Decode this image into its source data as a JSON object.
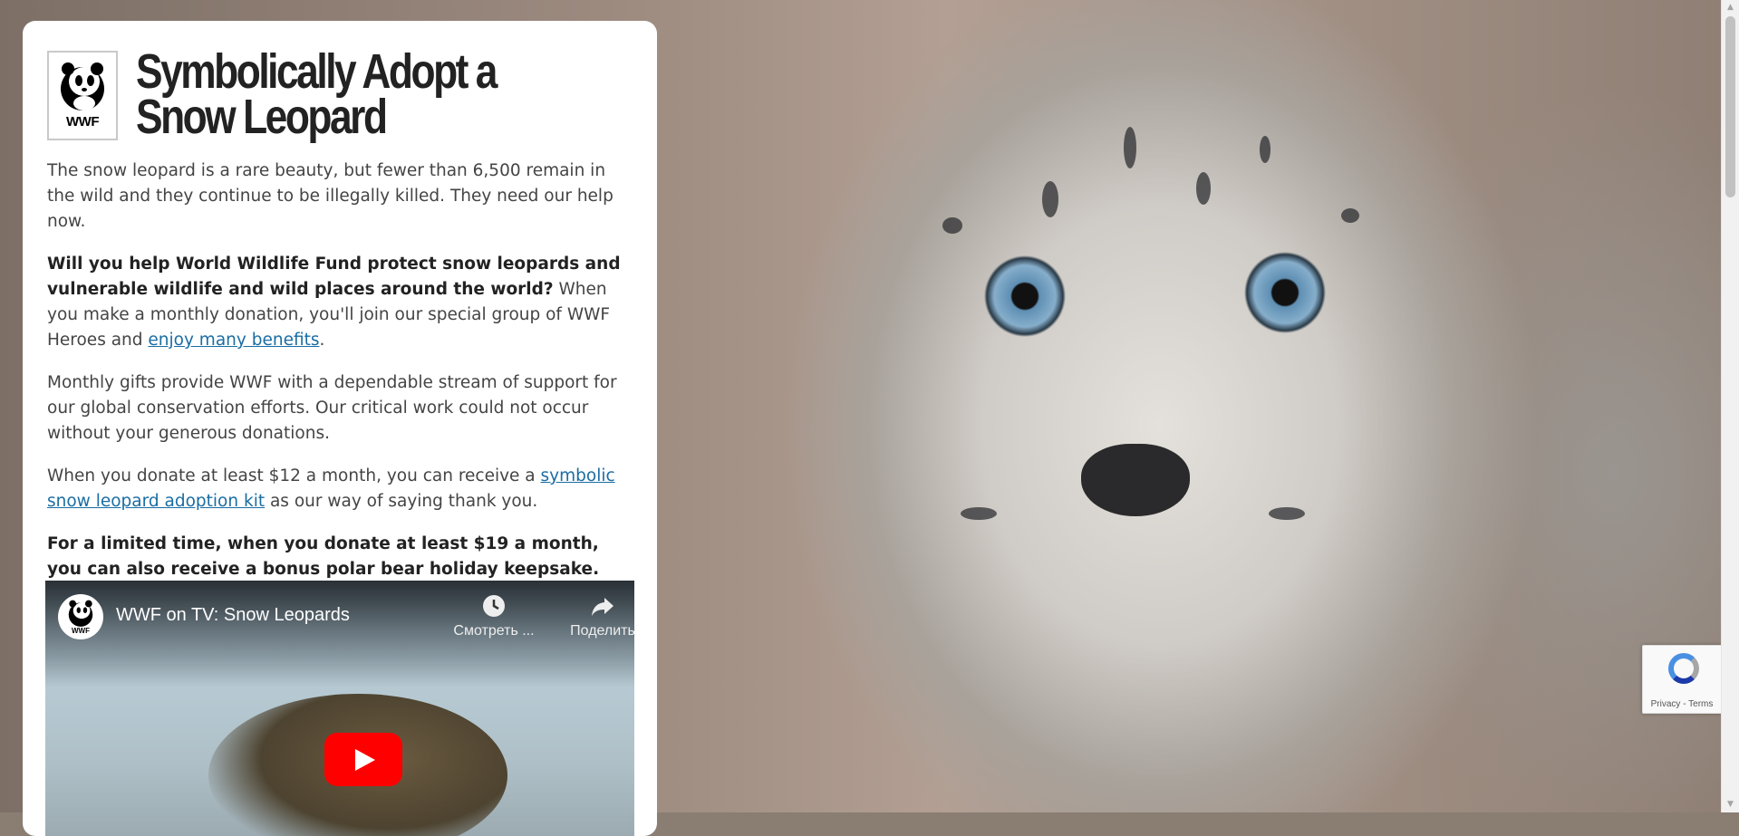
{
  "page": {
    "title_line": "Symbolically Adopt a Snow Leopard",
    "logo_text": "WWF"
  },
  "content": {
    "p1": "The snow leopard is a rare beauty, but fewer than 6,500 remain in the wild and they continue to be illegally killed. They need our help now.",
    "p2_bold": "Will you help World Wildlife Fund protect snow leopards and vulnerable wildlife and wild places around the world?",
    "p2_text": " When you make a monthly donation, you'll join our special group of WWF Heroes and ",
    "p2_link": "enjoy many benefits",
    "p2_end": ".",
    "p3": "Monthly gifts provide WWF with a dependable stream of support for our global conservation efforts. Our critical work could not occur without your generous donations.",
    "p4_text": "When you donate at least $12 a month, you can receive a ",
    "p4_link": "symbolic snow leopard adoption kit",
    "p4_end": " as our way of saying thank you.",
    "p5_bold": "For a limited time, when you donate at least $19 a month, you can also receive a bonus polar bear holiday keepsake."
  },
  "video": {
    "channel_logo_text": "WWF",
    "title": "WWF on TV: Snow Leopards",
    "watch_later_label": "Смотреть ...",
    "share_label": "Поделить"
  },
  "recaptcha": {
    "links": "Privacy - Terms"
  },
  "colors": {
    "link": "#1a6da3",
    "play_button": "#ff0000"
  },
  "icons": [
    "wwf-panda-icon",
    "clock-icon",
    "share-icon",
    "play-icon",
    "recaptcha-icon"
  ]
}
